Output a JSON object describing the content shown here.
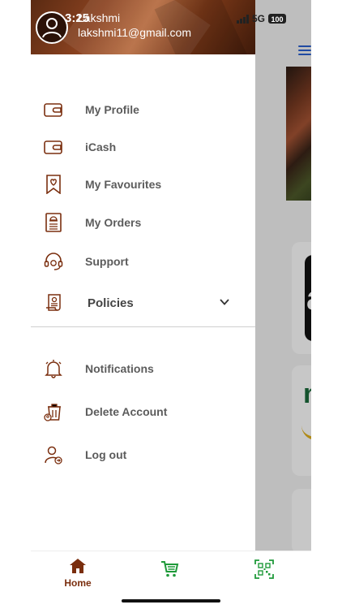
{
  "status_bar": {
    "time": "3:25",
    "network": "5G",
    "battery": "100"
  },
  "user": {
    "name": "Lakshmi",
    "email": "lakshmi11@gmail.com"
  },
  "menu": {
    "items": [
      {
        "label": "My Profile",
        "icon": "wallet-icon"
      },
      {
        "label": "iCash",
        "icon": "wallet-icon"
      },
      {
        "label": "My Favourites",
        "icon": "bookmark-heart-icon"
      },
      {
        "label": "My Orders",
        "icon": "receipt-icon"
      },
      {
        "label": "Support",
        "icon": "headset-icon"
      },
      {
        "label": "Policies",
        "icon": "scroll-icon"
      }
    ],
    "items_bottom": [
      {
        "label": "Notifications",
        "icon": "bell-icon"
      },
      {
        "label": "Delete Account",
        "icon": "trash-user-icon"
      },
      {
        "label": "Log out",
        "icon": "logout-user-icon"
      }
    ]
  },
  "background": {
    "card_1_text": "all",
    "card_2_text": "nis",
    "card_2_subtext": "eat"
  },
  "bottom_nav": {
    "home_label": "Home"
  },
  "colors": {
    "brand": "#7a2e0e",
    "nav_green": "#1f9a3a",
    "icon_stroke": "#7a2e0e"
  }
}
